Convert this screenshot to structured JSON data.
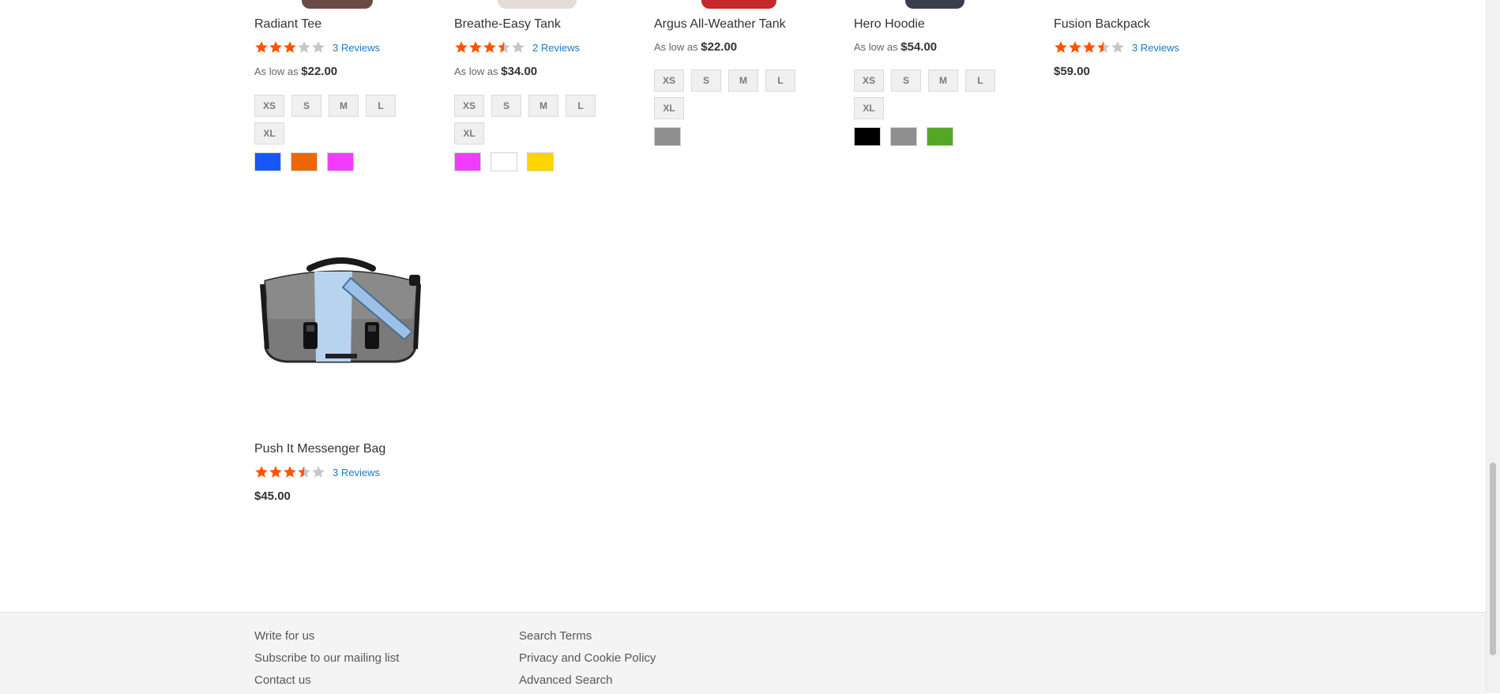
{
  "products": [
    {
      "name": "Radiant Tee",
      "rating_fraction": 0.6,
      "reviews": "3 Reviews",
      "price_prefix": "As low as",
      "price": "$22.00",
      "sizes": [
        "XS",
        "S",
        "M",
        "L",
        "XL"
      ],
      "swatches": [
        "#1857f7",
        "#eb6703",
        "#ef3dff"
      ]
    },
    {
      "name": "Breathe-Easy Tank",
      "rating_fraction": 0.7,
      "reviews": "2 Reviews",
      "price_prefix": "As low as",
      "price": "$34.00",
      "sizes": [
        "XS",
        "S",
        "M",
        "L",
        "XL"
      ],
      "swatches": [
        "#ef3dff",
        "#ffffff",
        "#ffd500"
      ]
    },
    {
      "name": "Argus All-Weather Tank",
      "price_prefix": "As low as",
      "price": "$22.00",
      "sizes": [
        "XS",
        "S",
        "M",
        "L",
        "XL"
      ],
      "swatches": [
        "#8f8f8f"
      ]
    },
    {
      "name": "Hero Hoodie",
      "price_prefix": "As low as",
      "price": "$54.00",
      "sizes": [
        "XS",
        "S",
        "M",
        "L",
        "XL"
      ],
      "swatches": [
        "#000000",
        "#8f8f8f",
        "#53a828"
      ]
    },
    {
      "name": "Fusion Backpack",
      "rating_fraction": 0.7,
      "reviews": "3 Reviews",
      "price": "$59.00"
    },
    {
      "name": "Push It Messenger Bag",
      "rating_fraction": 0.7,
      "reviews": "3 Reviews",
      "price": "$45.00"
    }
  ],
  "footer": {
    "col1": [
      "Write for us",
      "Subscribe to our mailing list",
      "Contact us"
    ],
    "col2": [
      "Search Terms",
      "Privacy and Cookie Policy",
      "Advanced Search"
    ]
  },
  "colors": {
    "star_filled": "#ff5501",
    "star_empty": "#c7c7c7",
    "link": "#1979c3",
    "footer_bg": "#f4f4f4"
  }
}
